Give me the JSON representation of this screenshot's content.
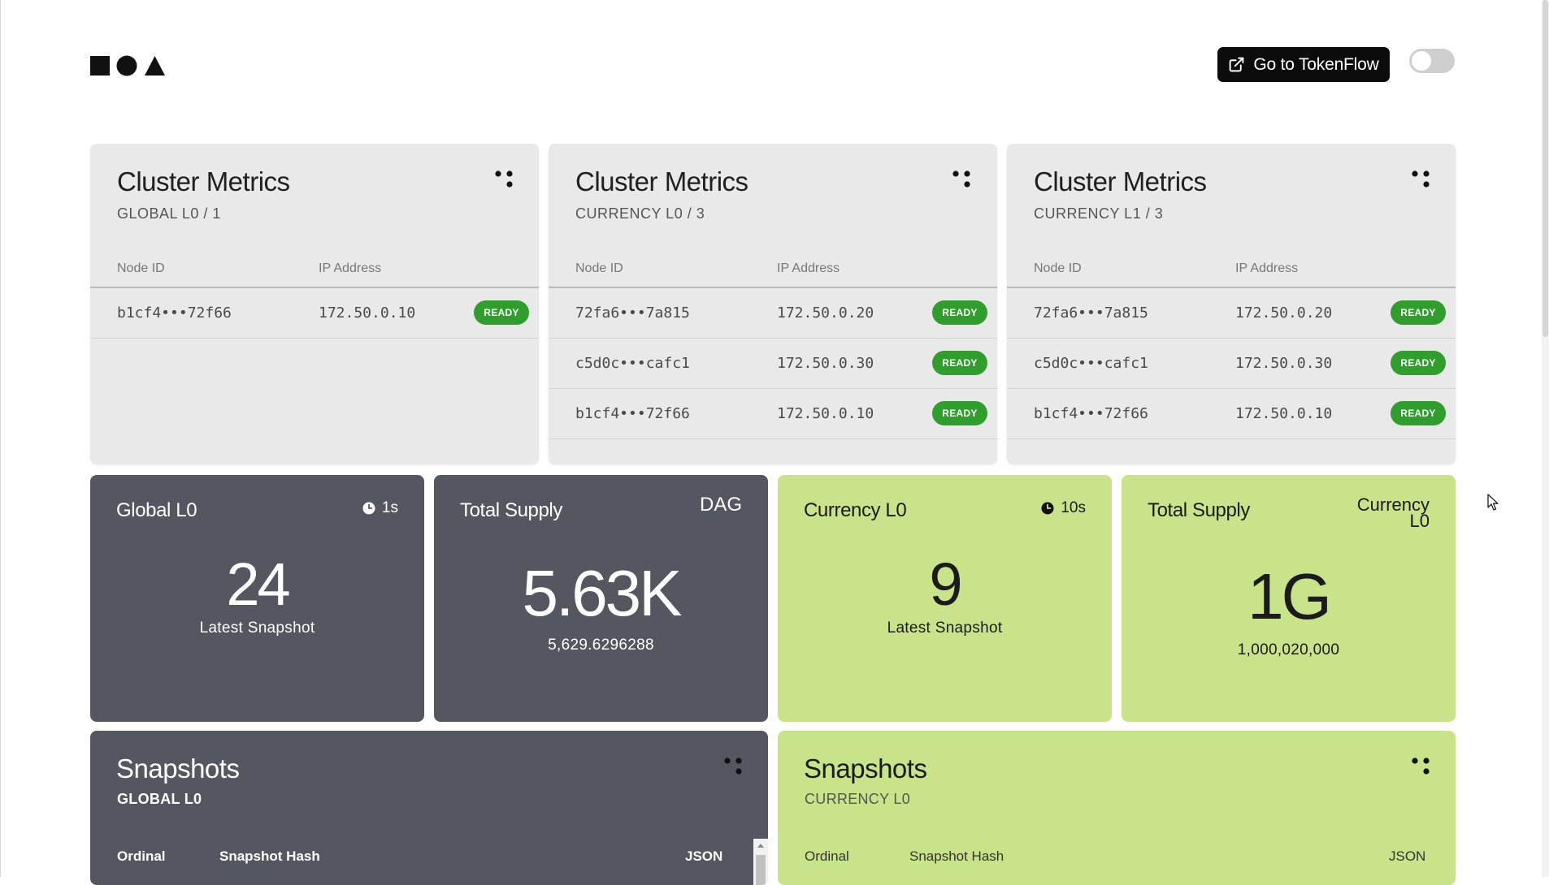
{
  "header": {
    "logo": "logo-square-circle-triangle",
    "tokenflow_label": "Go to TokenFlow",
    "theme_toggle": "off"
  },
  "clusters": [
    {
      "title": "Cluster Metrics",
      "subtitle": "GLOBAL L0 / 1",
      "col_node": "Node ID",
      "col_ip": "IP Address",
      "rows": [
        {
          "id": "b1cf4•••72f66",
          "ip": "172.50.0.10",
          "status": "READY"
        }
      ]
    },
    {
      "title": "Cluster Metrics",
      "subtitle": "CURRENCY L0 / 3",
      "col_node": "Node ID",
      "col_ip": "IP Address",
      "rows": [
        {
          "id": "72fa6•••7a815",
          "ip": "172.50.0.20",
          "status": "READY"
        },
        {
          "id": "c5d0c•••cafc1",
          "ip": "172.50.0.30",
          "status": "READY"
        },
        {
          "id": "b1cf4•••72f66",
          "ip": "172.50.0.10",
          "status": "READY"
        }
      ]
    },
    {
      "title": "Cluster Metrics",
      "subtitle": "CURRENCY L1 / 3",
      "col_node": "Node ID",
      "col_ip": "IP Address",
      "rows": [
        {
          "id": "72fa6•••7a815",
          "ip": "172.50.0.20",
          "status": "READY"
        },
        {
          "id": "c5d0c•••cafc1",
          "ip": "172.50.0.30",
          "status": "READY"
        },
        {
          "id": "b1cf4•••72f66",
          "ip": "172.50.0.10",
          "status": "READY"
        }
      ]
    }
  ],
  "stats": {
    "global_l0": {
      "title": "Global L0",
      "timer": "1s",
      "value": "24",
      "label": "Latest Snapshot"
    },
    "total_supply_dag": {
      "title": "Total Supply",
      "unit": "DAG",
      "value": "5.63K",
      "exact": "5,629.6296288"
    },
    "currency_l0": {
      "title": "Currency L0",
      "timer": "10s",
      "value": "9",
      "label": "Latest Snapshot"
    },
    "total_supply_currency": {
      "title": "Total Supply",
      "unit_line1": "Currency",
      "unit_line2": "L0",
      "value": "1G",
      "exact": "1,000,020,000"
    }
  },
  "snapshots": {
    "global": {
      "title": "Snapshots",
      "subtitle": "GLOBAL L0",
      "col_ordinal": "Ordinal",
      "col_hash": "Snapshot Hash",
      "col_json": "JSON"
    },
    "currency": {
      "title": "Snapshots",
      "subtitle": "CURRENCY L0",
      "col_ordinal": "Ordinal",
      "col_hash": "Snapshot Hash",
      "col_json": "JSON"
    }
  },
  "colors": {
    "dark_card": "#545660",
    "green_card": "#c9e38a",
    "ready_badge": "#2f9e2c",
    "metric_card": "#e9e9ea"
  }
}
